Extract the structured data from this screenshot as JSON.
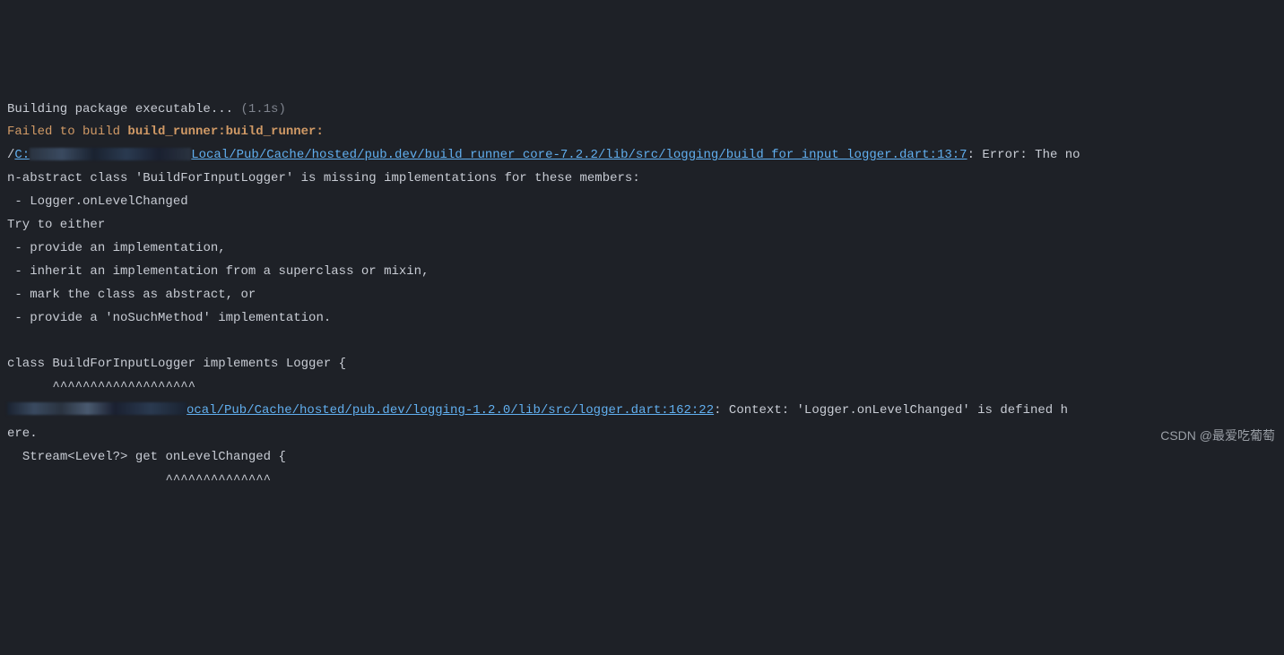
{
  "line1_prefix": "Building package executable... ",
  "line1_time": "(1.1s)",
  "line2_prefix": "Failed to build ",
  "line2_bold": "build_runner:build_runner:",
  "line3_slash": "/",
  "line3_c": "C:",
  "line3_link_tail": "Local/Pub/Cache/hosted/pub.dev/build_runner_core-7.2.2/lib/src/logging/build_for_input_logger.dart:13:7",
  "line3_after": ": Error: The no",
  "line4": "n-abstract class 'BuildForInputLogger' is missing implementations for these members:",
  "line5": " - Logger.onLevelChanged",
  "line6": "Try to either",
  "line7": " - provide an implementation,",
  "line8": " - inherit an implementation from a superclass or mixin,",
  "line9": " - mark the class as abstract, or",
  "line10": " - provide a 'noSuchMethod' implementation.",
  "blank": "",
  "line12": "class BuildForInputLogger implements Logger {",
  "line13": "      ^^^^^^^^^^^^^^^^^^^",
  "line14_link_tail": "ocal/Pub/Cache/hosted/pub.dev/logging-1.2.0/lib/src/logger.dart:162:22",
  "line14_after": ": Context: 'Logger.onLevelChanged' is defined h",
  "line15": "ere.",
  "line16": "  Stream<Level?> get onLevelChanged {",
  "line17": "                     ^^^^^^^^^^^^^^",
  "watermark": "CSDN @最爱吃葡萄"
}
